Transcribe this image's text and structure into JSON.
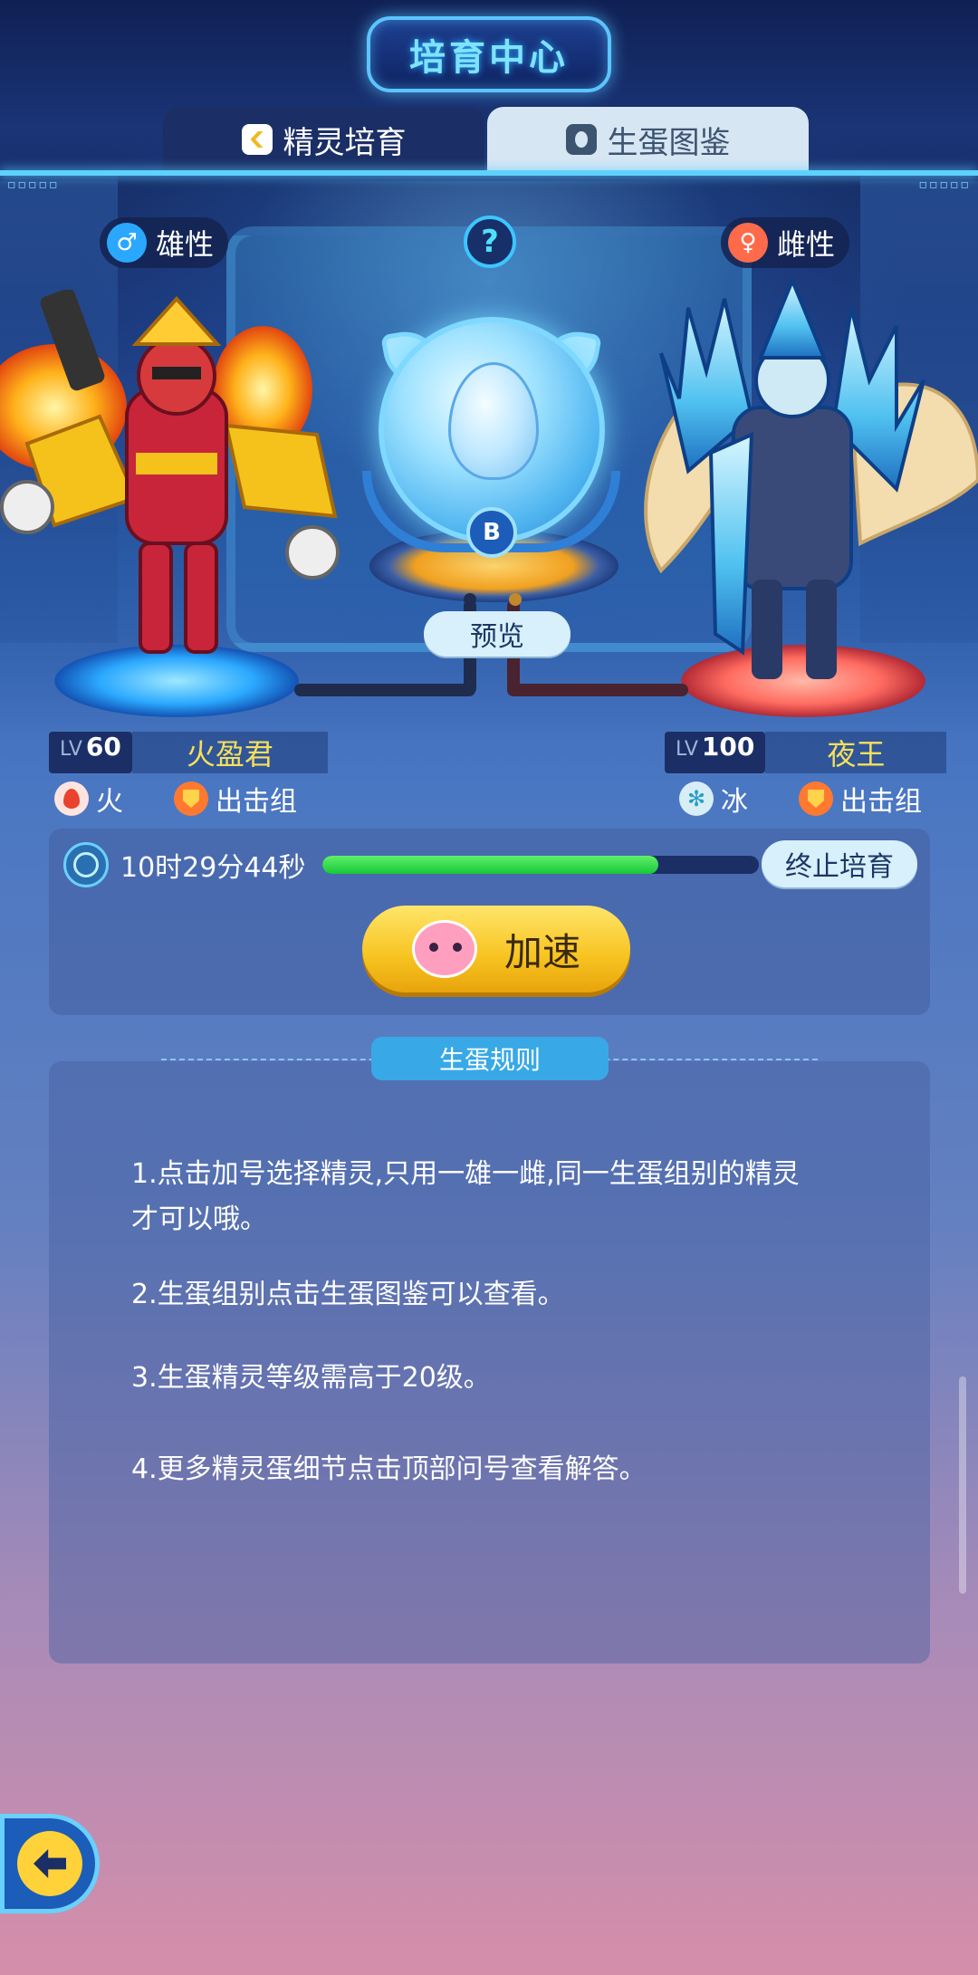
{
  "header": {
    "title": "培育中心"
  },
  "tabs": [
    {
      "label": "精灵培育",
      "active": true
    },
    {
      "label": "生蛋图鉴",
      "active": false
    }
  ],
  "help": {
    "label": "?"
  },
  "male": {
    "gender": "雄性",
    "level_prefix": "LV",
    "level": "60",
    "name": "火盈君",
    "element": "火",
    "group": "出击组"
  },
  "female": {
    "gender": "雌性",
    "level_prefix": "LV",
    "level": "100",
    "name": "夜王",
    "element": "冰",
    "group": "出击组"
  },
  "egg": {
    "logo": "B",
    "preview_label": "预览"
  },
  "breeding": {
    "time_remaining": "10时29分44秒",
    "progress_percent": 77,
    "stop_label": "终止培育",
    "speed_label": "加速"
  },
  "rules": {
    "title": "生蛋规则",
    "items": [
      "1.点击加号选择精灵,只用一雄一雌,同一生蛋组别的精灵才可以哦。",
      "2.生蛋组别点击生蛋图鉴可以查看。",
      "3.生蛋精灵等级需高于20级。",
      "4.更多精灵蛋细节点击顶部问号查看解答。"
    ]
  },
  "colors": {
    "accent_cyan": "#5fd1ff",
    "progress_green": "#18c83a",
    "speed_yellow": "#f7c320",
    "name_yellow": "#f6e05a"
  },
  "icons": {
    "male": "male-icon",
    "female": "female-icon",
    "fire": "fire-element-icon",
    "ice": "ice-element-icon",
    "group": "shield-icon",
    "timer": "stopwatch-icon",
    "back": "back-arrow-icon"
  }
}
